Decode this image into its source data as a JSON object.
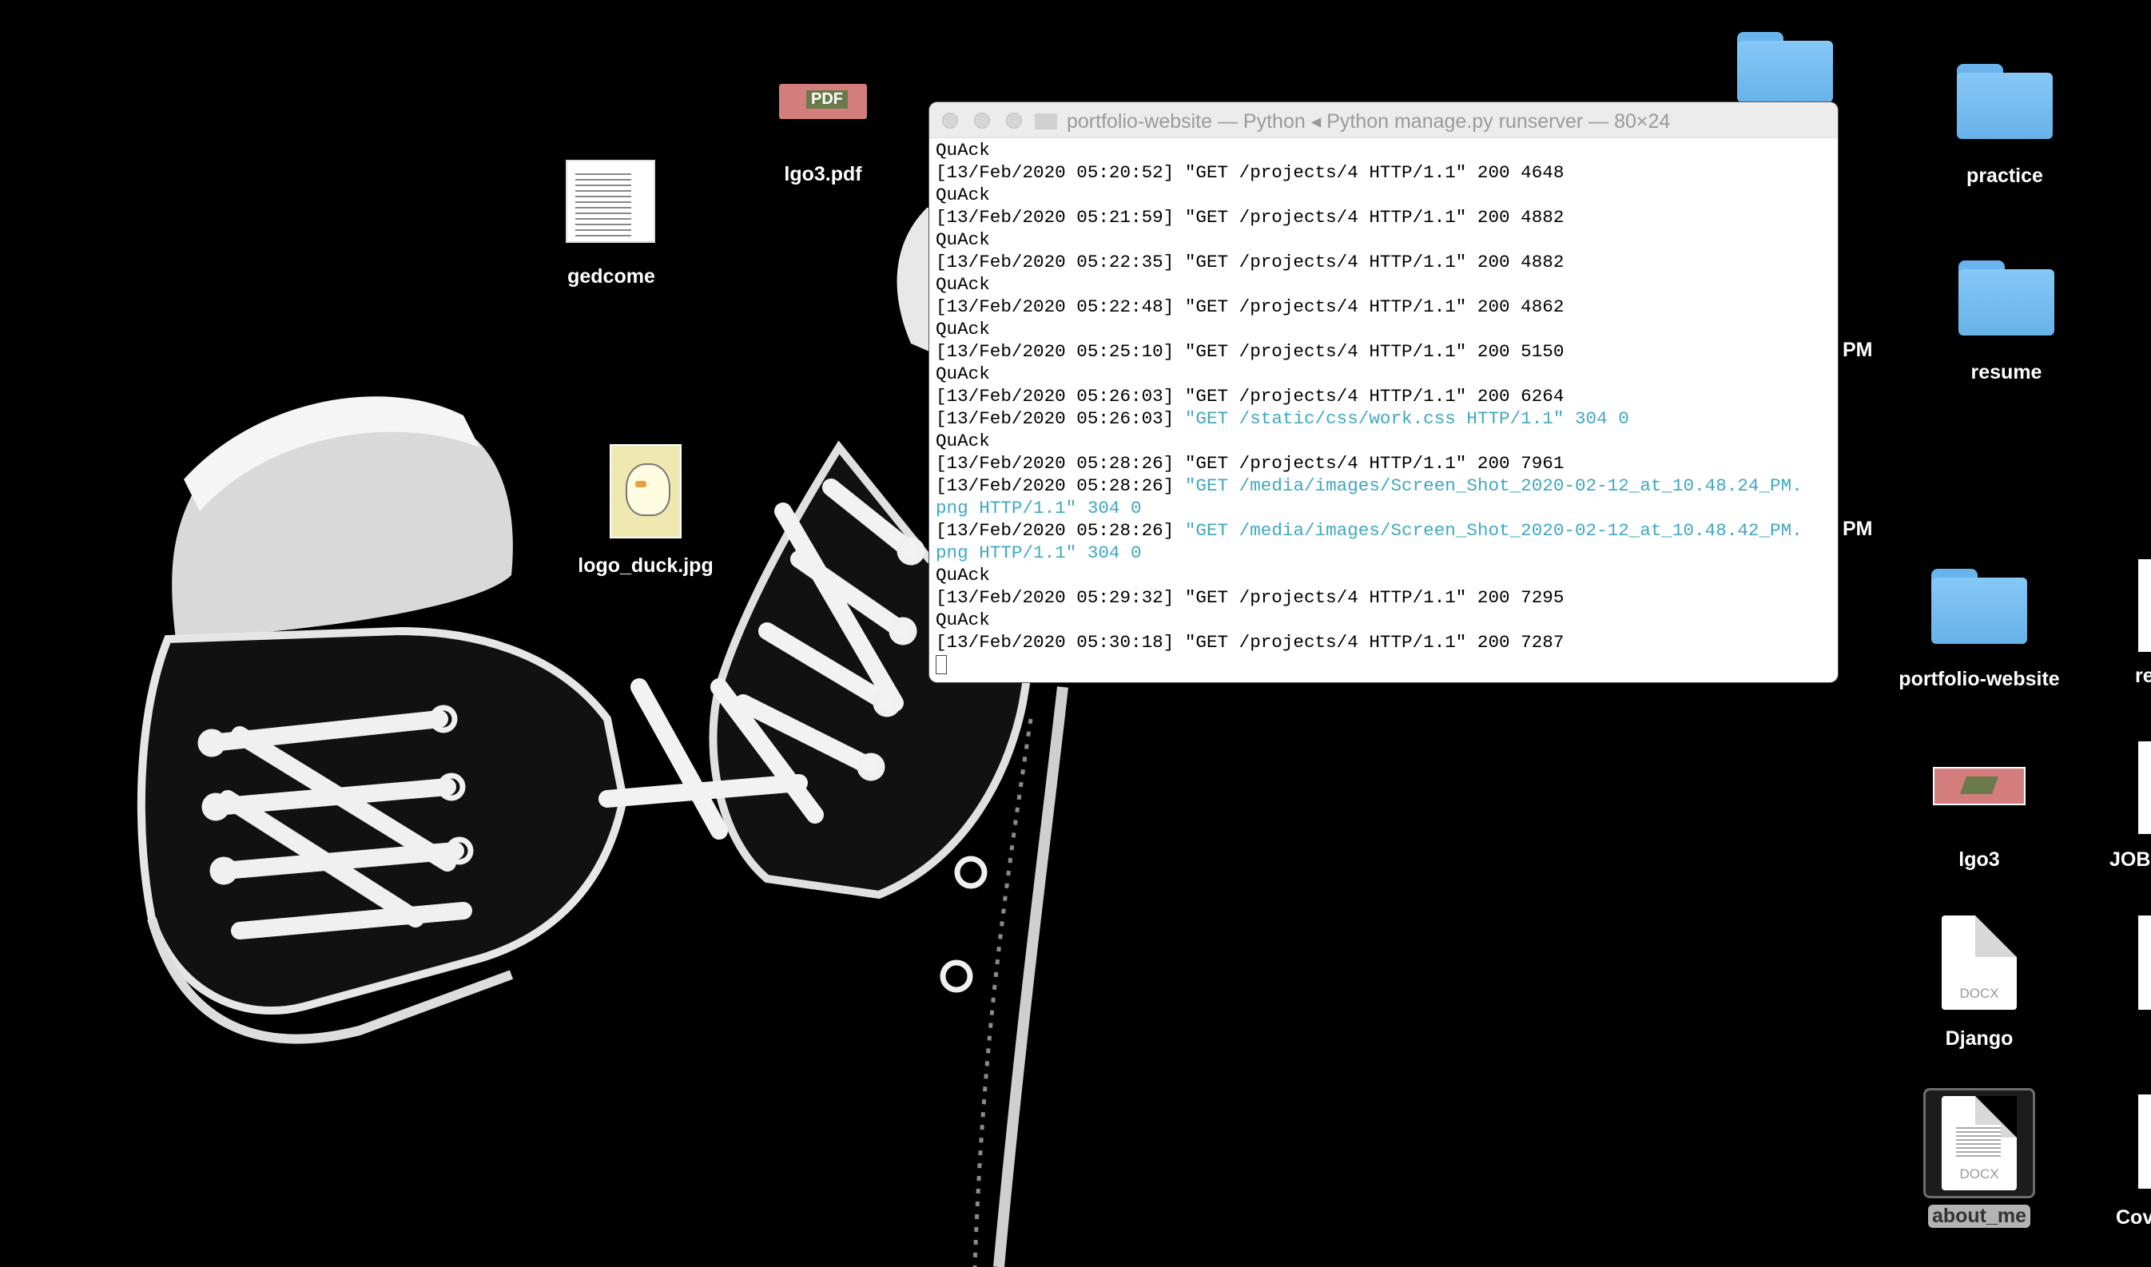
{
  "terminal": {
    "title": "portfolio-website — Python ◂ Python manage.py runserver — 80×24",
    "lines": [
      {
        "text": "QuAck",
        "style": "plain"
      },
      {
        "text": "[13/Feb/2020 05:20:52] \"GET /projects/4 HTTP/1.1\" 200 4648",
        "style": "plain"
      },
      {
        "text": "QuAck",
        "style": "plain"
      },
      {
        "text": "[13/Feb/2020 05:21:59] \"GET /projects/4 HTTP/1.1\" 200 4882",
        "style": "plain"
      },
      {
        "text": "QuAck",
        "style": "plain"
      },
      {
        "text": "[13/Feb/2020 05:22:35] \"GET /projects/4 HTTP/1.1\" 200 4882",
        "style": "plain"
      },
      {
        "text": "QuAck",
        "style": "plain"
      },
      {
        "text": "[13/Feb/2020 05:22:48] \"GET /projects/4 HTTP/1.1\" 200 4862",
        "style": "plain"
      },
      {
        "text": "QuAck",
        "style": "plain"
      },
      {
        "text": "[13/Feb/2020 05:25:10] \"GET /projects/4 HTTP/1.1\" 200 5150",
        "style": "plain"
      },
      {
        "text": "QuAck",
        "style": "plain"
      },
      {
        "text": "[13/Feb/2020 05:26:03] \"GET /projects/4 HTTP/1.1\" 200 6264",
        "style": "plain"
      },
      {
        "prefix": "[13/Feb/2020 05:26:03] ",
        "text": "\"GET /static/css/work.css HTTP/1.1\" 304 0",
        "style": "cyan"
      },
      {
        "text": "QuAck",
        "style": "plain"
      },
      {
        "text": "[13/Feb/2020 05:28:26] \"GET /projects/4 HTTP/1.1\" 200 7961",
        "style": "plain"
      },
      {
        "prefix": "[13/Feb/2020 05:28:26] ",
        "text": "\"GET /media/images/Screen_Shot_2020-02-12_at_10.48.24_PM.",
        "style": "cyan"
      },
      {
        "text": "png HTTP/1.1\" 304 0",
        "style": "cyan"
      },
      {
        "prefix": "[13/Feb/2020 05:28:26] ",
        "text": "\"GET /media/images/Screen_Shot_2020-02-12_at_10.48.42_PM.",
        "style": "cyan"
      },
      {
        "text": "png HTTP/1.1\" 304 0",
        "style": "cyan"
      },
      {
        "text": "QuAck",
        "style": "plain"
      },
      {
        "text": "[13/Feb/2020 05:29:32] \"GET /projects/4 HTTP/1.1\" 200 7295",
        "style": "plain"
      },
      {
        "text": "QuAck",
        "style": "plain"
      },
      {
        "text": "[13/Feb/2020 05:30:18] \"GET /projects/4 HTTP/1.1\" 200 7287",
        "style": "plain"
      }
    ]
  },
  "desktop": {
    "icons": {
      "lgo3_pdf": "lgo3.pdf",
      "gedcome": "gedcome",
      "logo_duck": "logo_duck.jpg",
      "practice": "practice",
      "resume": "resume",
      "portfolio_website": "portfolio-website",
      "lgo3": "lgo3",
      "django": "Django",
      "about_me": "about_me",
      "partial_re": "re",
      "partial_job": "JOB",
      "partial_cov": "Cov"
    },
    "docx_ext": "DOCX",
    "pdf_badge": "PDF",
    "clipped_pm_1": "PM",
    "clipped_pm_2": "PM"
  },
  "colors": {
    "folder_blue": "#6fb8ef",
    "terminal_cyan": "#3fa8c2",
    "selection_label": "#b3b3b3"
  }
}
